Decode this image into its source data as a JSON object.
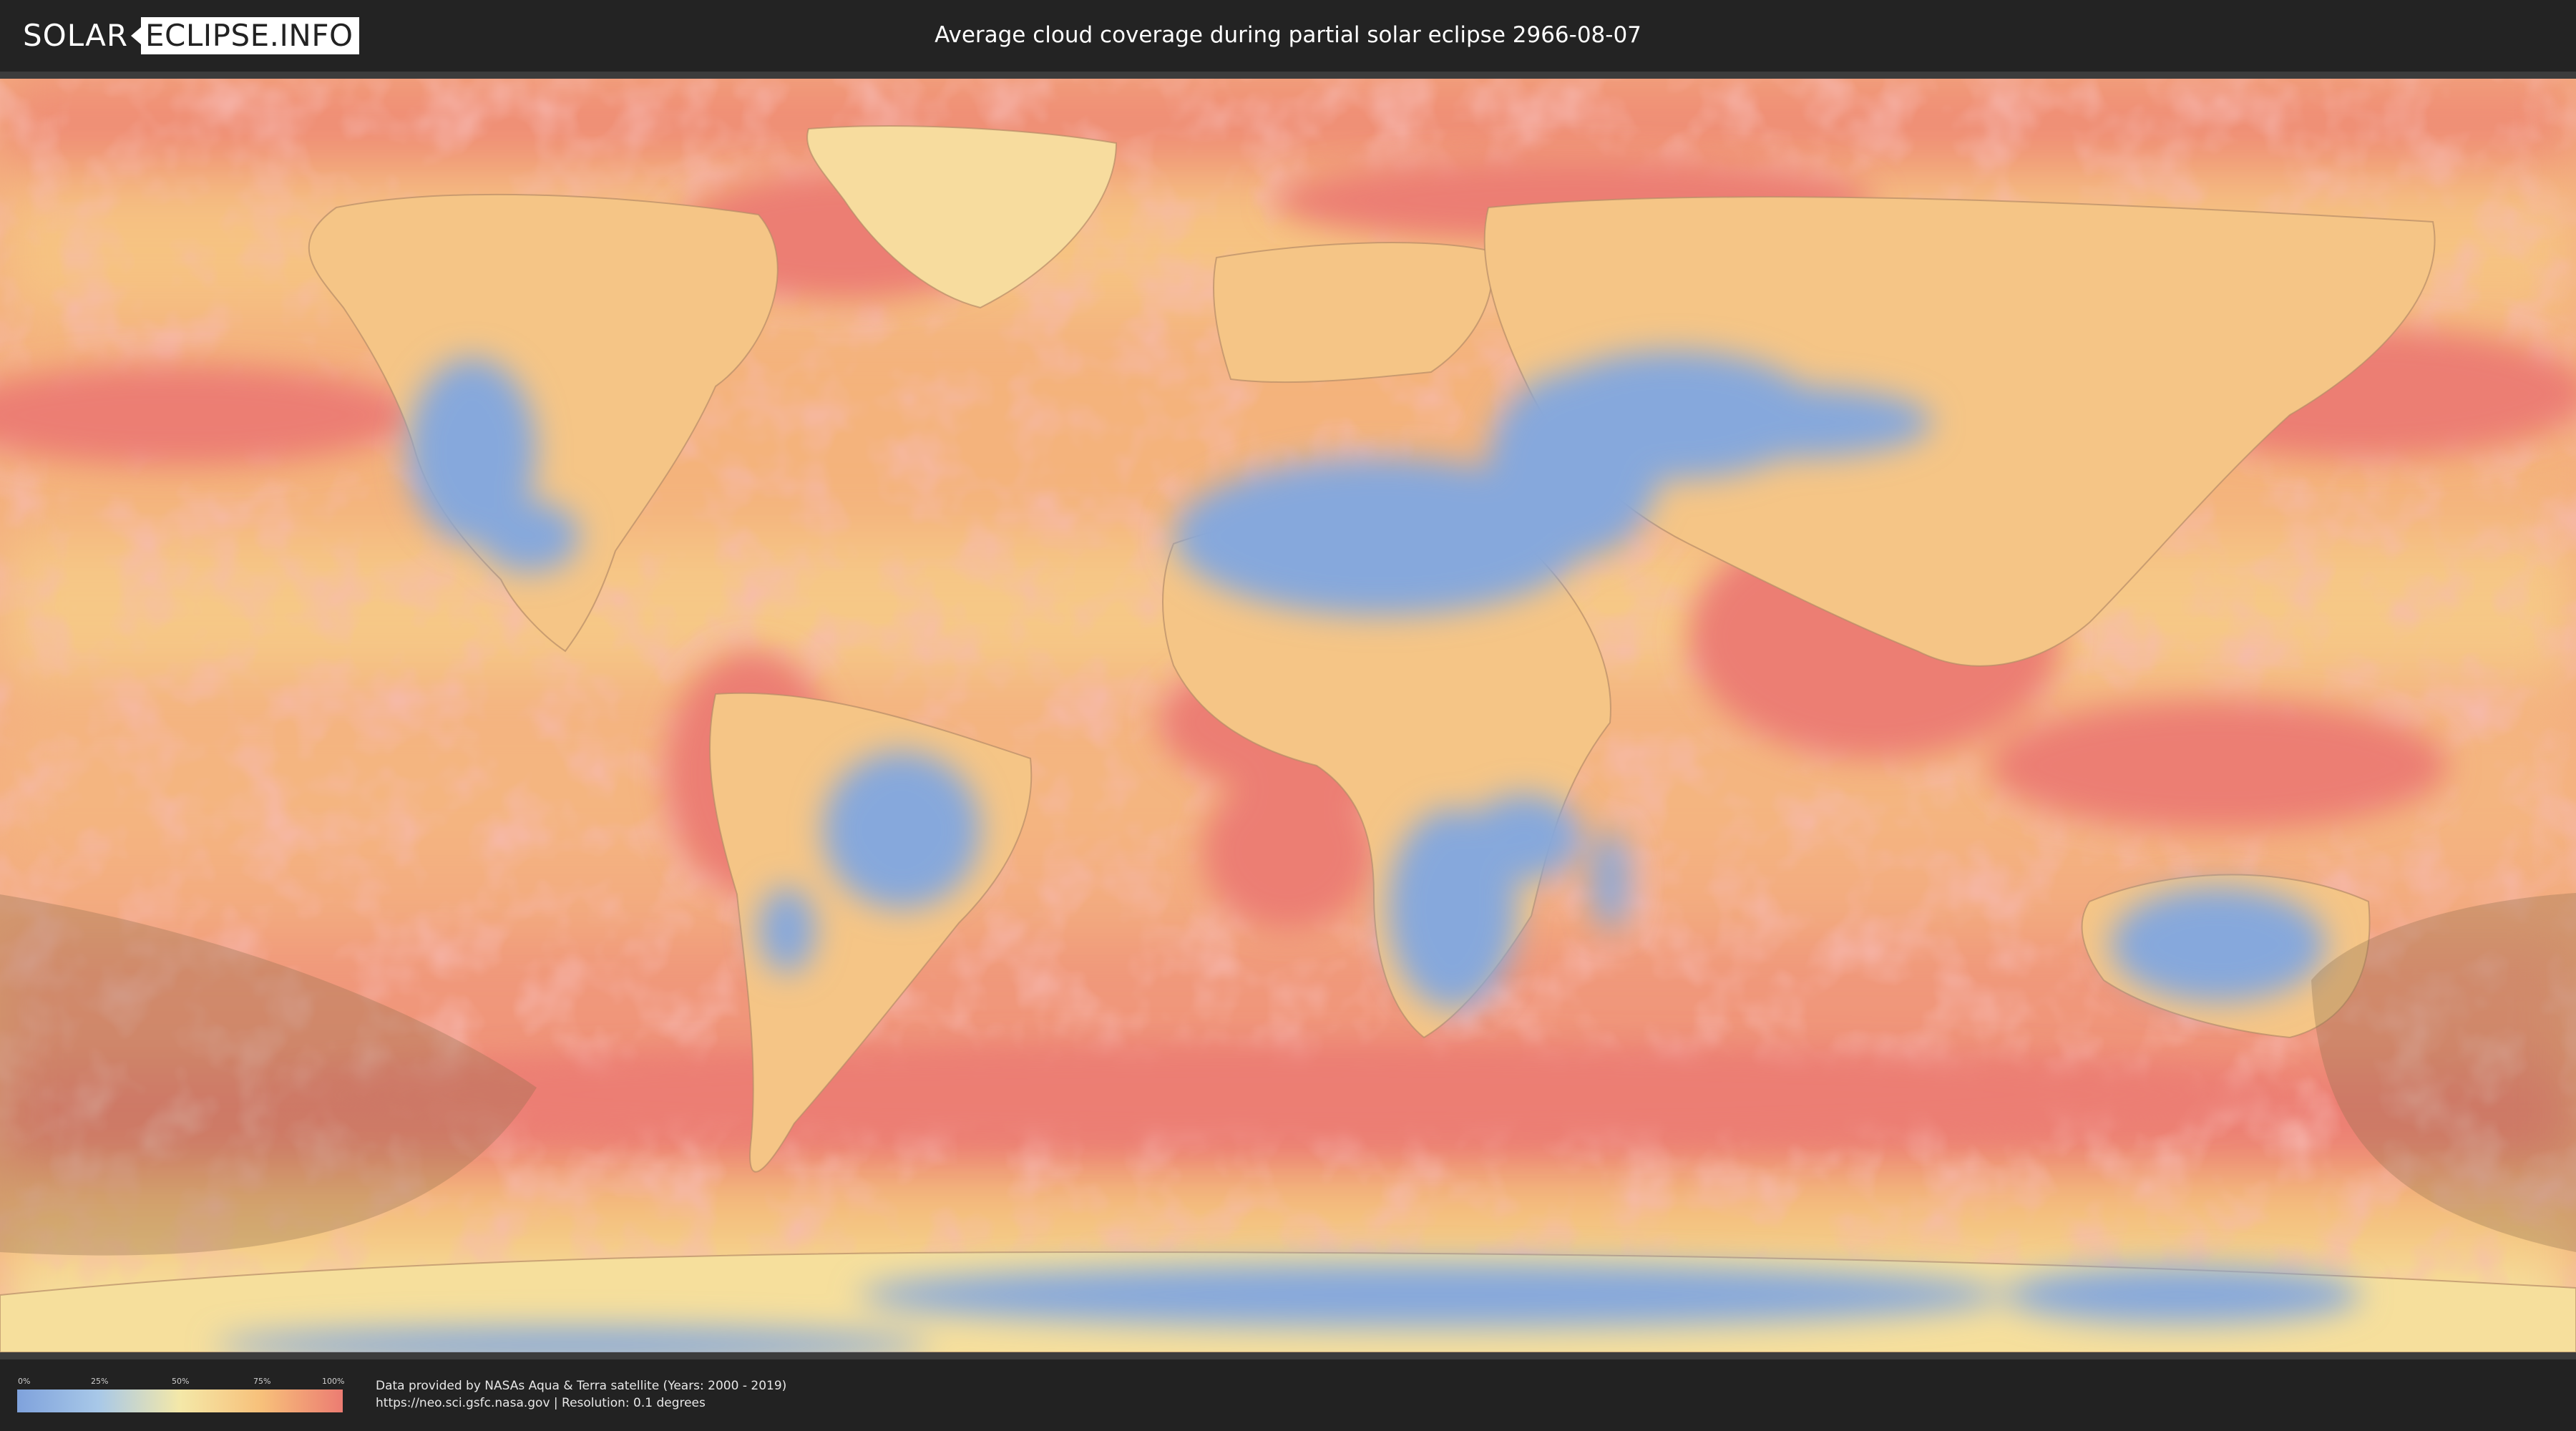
{
  "header": {
    "logo_left": "SOLAR",
    "logo_right": "ECLIPSE.INFO",
    "title": "Average cloud coverage during partial solar eclipse 2966-08-07"
  },
  "legend": {
    "ticks": [
      "0%",
      "25%",
      "50%",
      "75%",
      "100%"
    ],
    "colors": [
      "#7fa2dc",
      "#a8c8e8",
      "#f4e8a8",
      "#f7c07a",
      "#ec7c72"
    ]
  },
  "footer": {
    "attribution_line1": "Data provided by NASAs Aqua & Terra satellite (Years: 2000 - 2019)",
    "attribution_line2": "https://neo.sci.gsfc.nasa.gov | Resolution: 0.1 degrees"
  },
  "map": {
    "projection": "equirectangular",
    "ocean_color": "#f2a77c",
    "high_cloud_color": "#ec7c72",
    "clear_sky_color": "#7fa2dc",
    "eclipse_overlay_color": "#8c6e4a"
  }
}
